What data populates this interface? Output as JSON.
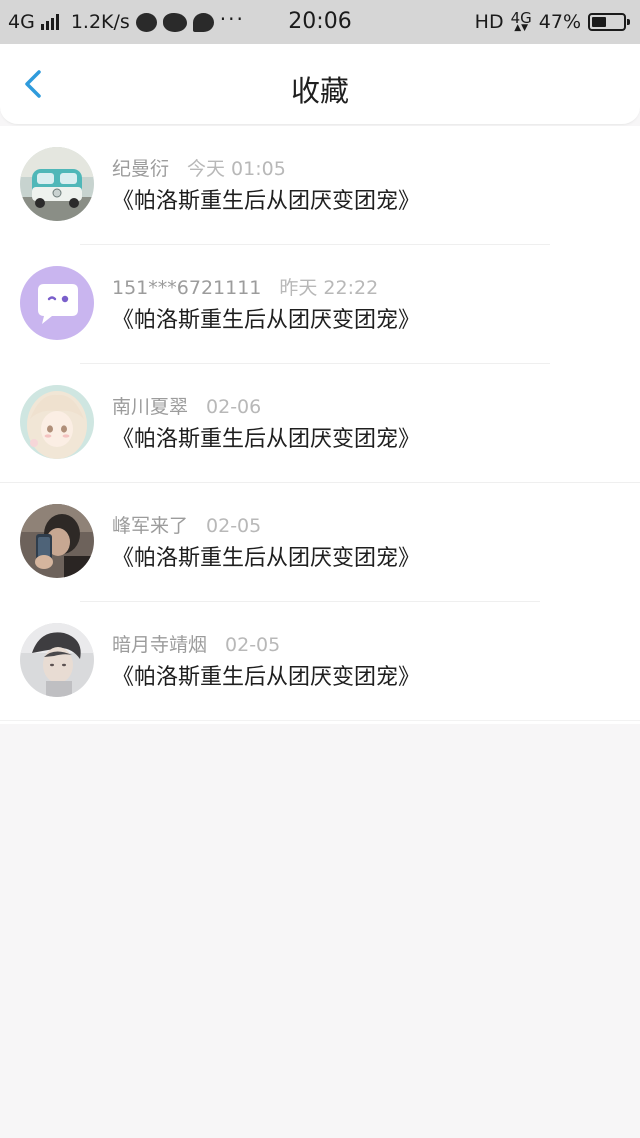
{
  "status_bar": {
    "network": "4G",
    "speed": "1.2K/s",
    "more": "···",
    "time": "20:06",
    "hd": "HD",
    "network_right": "4G",
    "network_right_arrows": "▲▼",
    "battery_percent": "47%",
    "battery_level": 0.47
  },
  "header": {
    "title": "收藏",
    "back_icon": "chevron-left-icon",
    "accent_color": "#2f9bdc"
  },
  "favorites": [
    {
      "author": "纪曼衍",
      "time": "今天 01:05",
      "title": "《帕洛斯重生后从团厌变团宠》",
      "avatar": "van-avatar"
    },
    {
      "author": "151***6721111",
      "time": "昨天 22:22",
      "title": "《帕洛斯重生后从团厌变团宠》",
      "avatar": "chat-bubble-avatar"
    },
    {
      "author": "南川夏翠",
      "time": "02-06",
      "title": "《帕洛斯重生后从团厌变团宠》",
      "avatar": "anime-girl-avatar"
    },
    {
      "author": "峰军来了",
      "time": "02-05",
      "title": "《帕洛斯重生后从团厌变团宠》",
      "avatar": "selfie-avatar"
    },
    {
      "author": "暗月寺靖烟",
      "time": "02-05",
      "title": "《帕洛斯重生后从团厌变团宠》",
      "avatar": "boy-portrait-avatar"
    }
  ]
}
